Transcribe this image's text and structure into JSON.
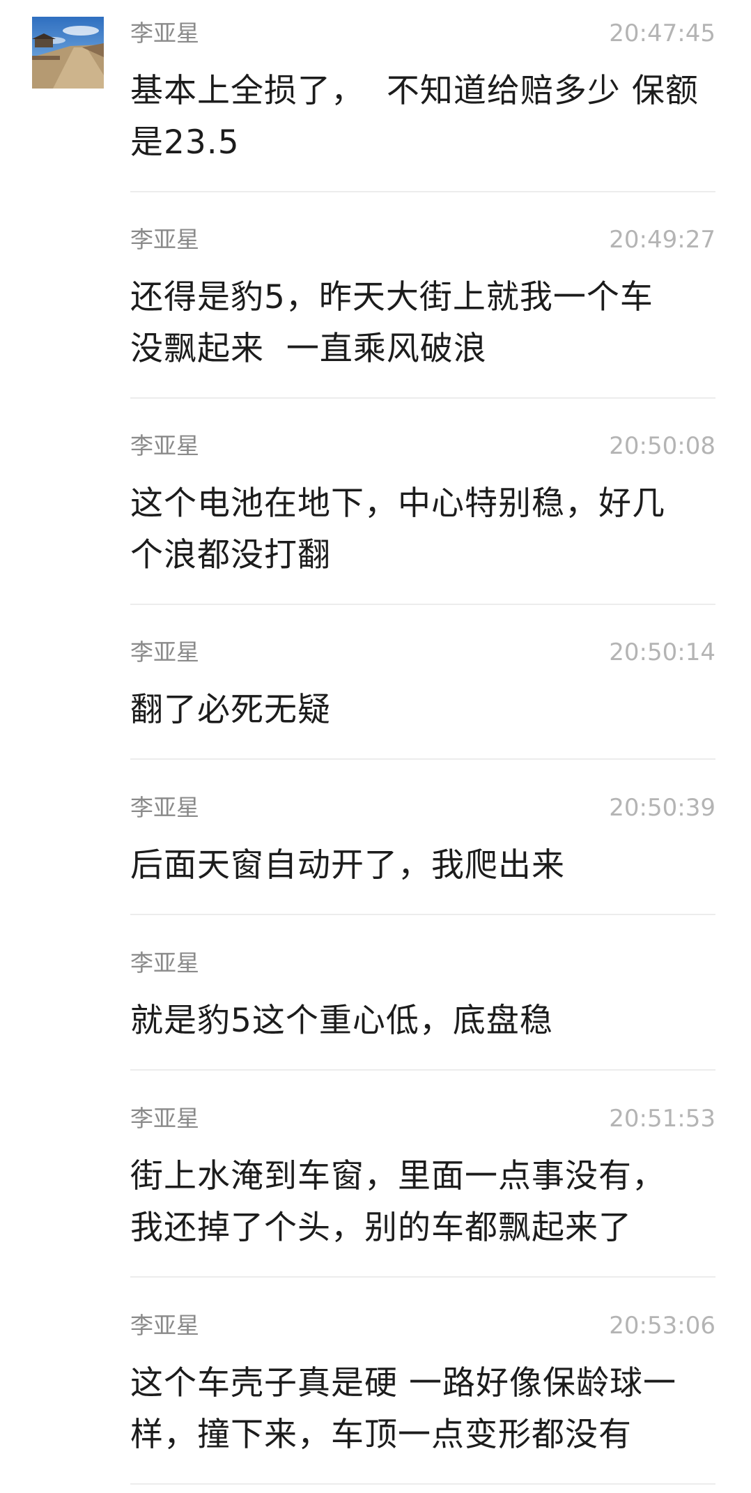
{
  "messages": [
    {
      "sender": "李亚星",
      "time": "20:47:45",
      "text": "基本上全损了，  不知道给赔多少 保额\n是23.5"
    },
    {
      "sender": "李亚星",
      "time": "20:49:27",
      "text": "还得是豹5，昨天大街上就我一个车\n没飘起来  一直乘风破浪"
    },
    {
      "sender": "李亚星",
      "time": "20:50:08",
      "text": "这个电池在地下，中心特别稳，好几\n个浪都没打翻"
    },
    {
      "sender": "李亚星",
      "time": "20:50:14",
      "text": "翻了必死无疑"
    },
    {
      "sender": "李亚星",
      "time": "20:50:39",
      "text": "后面天窗自动开了，我爬出来"
    },
    {
      "sender": "李亚星",
      "time": "",
      "text": "就是豹5这个重心低，底盘稳"
    },
    {
      "sender": "李亚星",
      "time": "20:51:53",
      "text": "街上水淹到车窗，里面一点事没有，\n我还掉了个头，别的车都飘起来了"
    },
    {
      "sender": "李亚星",
      "time": "20:53:06",
      "text": "这个车壳子真是硬 一路好像保龄球一\n样，撞下来，车顶一点变形都没有"
    }
  ]
}
